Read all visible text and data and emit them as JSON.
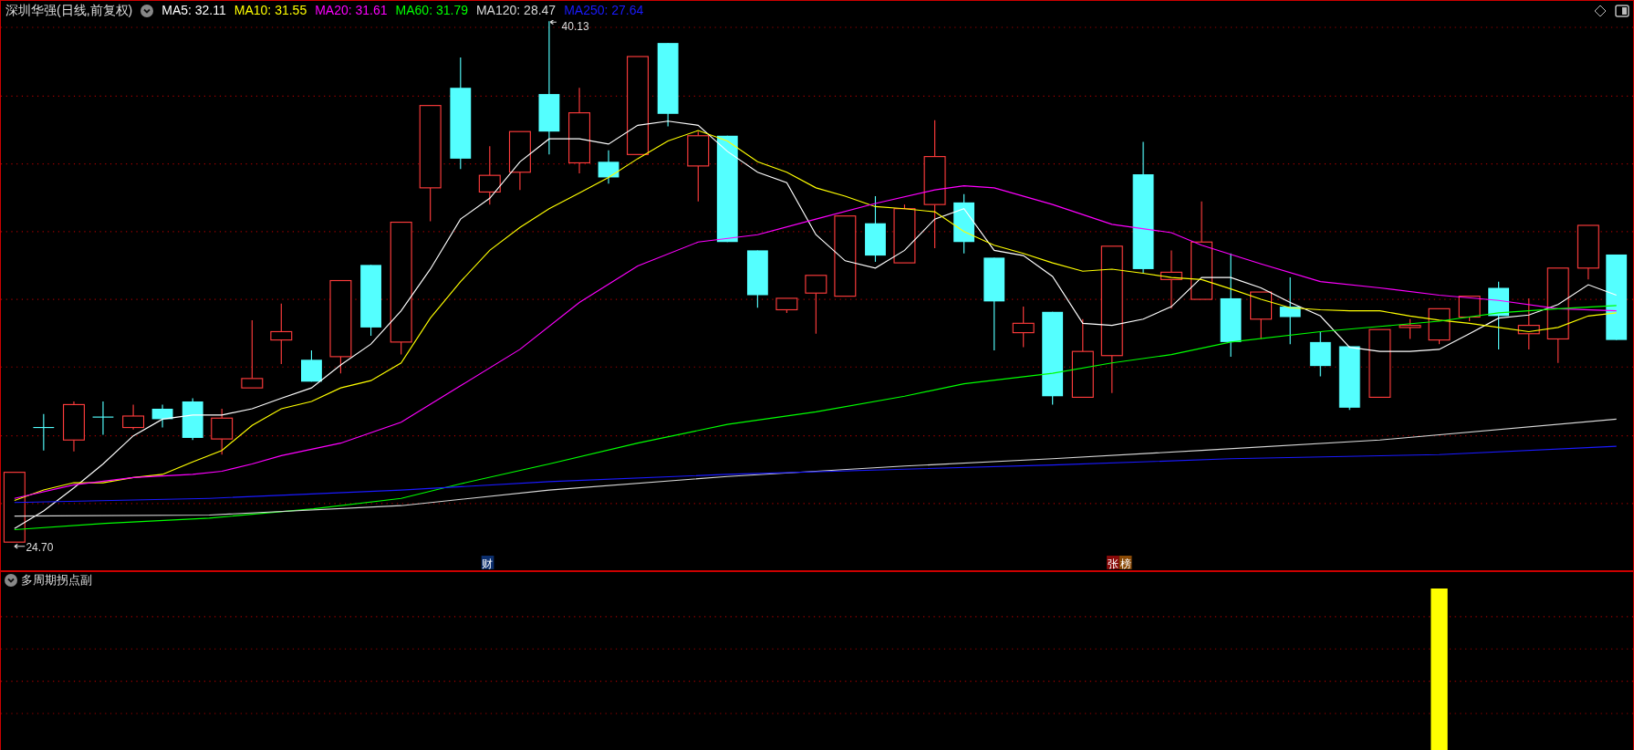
{
  "header": {
    "title": "深圳华强(日线,前复权)",
    "indicators": [
      {
        "label": "MA5: 32.11",
        "color": "#ffffff"
      },
      {
        "label": "MA10: 31.55",
        "color": "#ffff00"
      },
      {
        "label": "MA20: 31.61",
        "color": "#ff00ff"
      },
      {
        "label": "MA60: 31.79",
        "color": "#00ff00"
      },
      {
        "label": "MA120: 28.47",
        "color": "#d8d8d8"
      },
      {
        "label": "MA250: 27.64",
        "color": "#1a1aff"
      }
    ]
  },
  "chart": {
    "high_label": "40.13",
    "low_label": "24.70",
    "markers": [
      {
        "text": "财",
        "color": "#0c2f6e"
      },
      {
        "text": "张",
        "color": "#8a0a0a"
      },
      {
        "text": "榜",
        "color": "#8a4a06"
      }
    ]
  },
  "sub_panel": {
    "title": "多周期拐点副"
  }
}
